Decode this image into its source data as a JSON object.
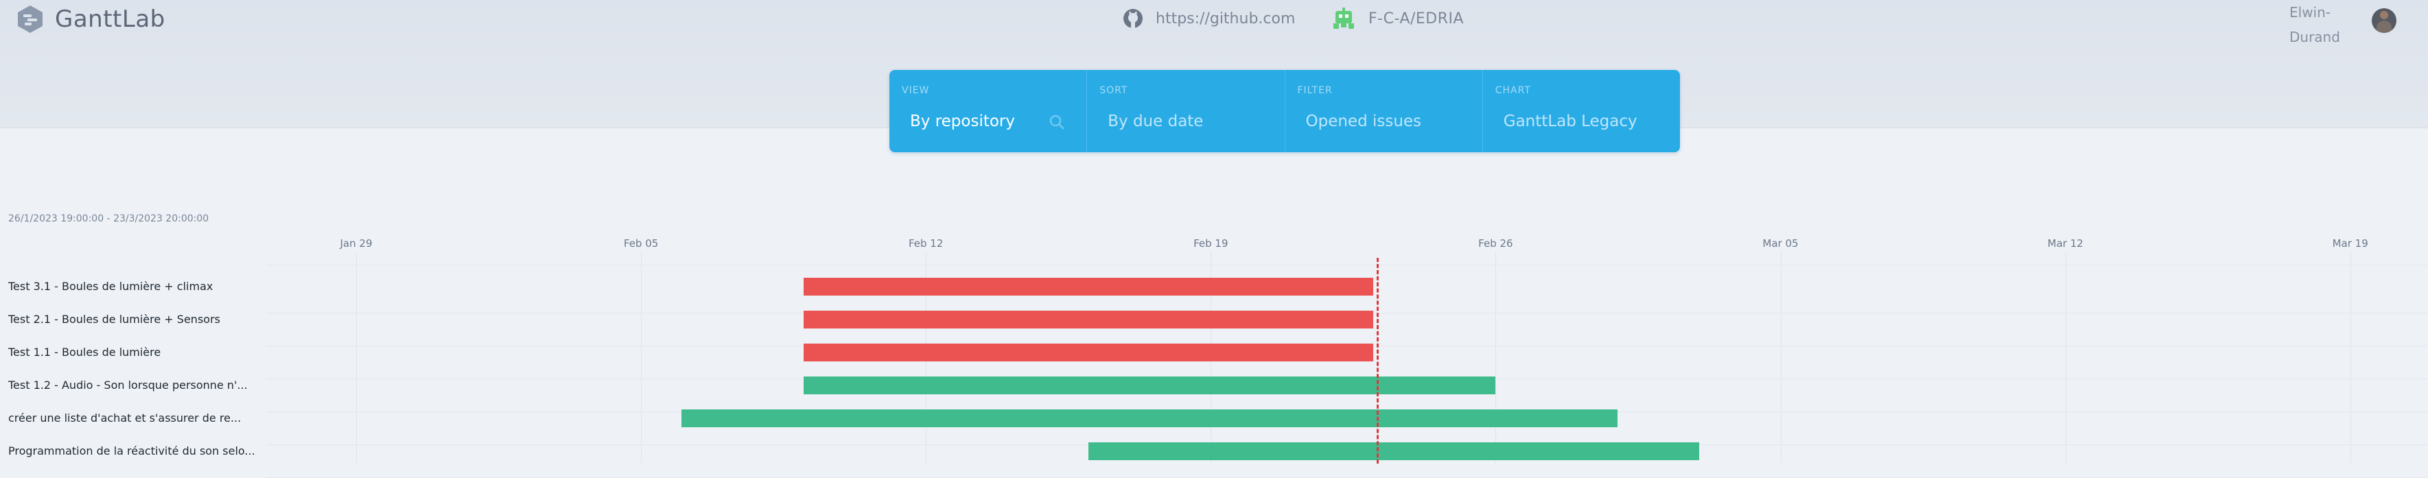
{
  "header": {
    "brand": "GanttLab",
    "source_url": "https://github.com",
    "repository": "F-C-A/EDRIA",
    "user_line1": "Elwin-",
    "user_line2": "Durand"
  },
  "toolbar": {
    "view": {
      "label": "VIEW",
      "value": "By repository"
    },
    "sort": {
      "label": "SORT",
      "value": "By due date"
    },
    "filter": {
      "label": "FILTER",
      "value": "Opened issues"
    },
    "chart": {
      "label": "CHART",
      "value": "GanttLab Legacy"
    }
  },
  "gantt": {
    "range": "26/1/2023 19:00:00 - 23/3/2023 20:00:00",
    "axis_ticks": [
      "Jan 29",
      "Feb 05",
      "Feb 12",
      "Feb 19",
      "Feb 26",
      "Mar 05",
      "Mar 12",
      "Mar 19"
    ],
    "rows": [
      {
        "label": "Test 3.1 - Boules de lumière + climax",
        "start": "2023-02-09",
        "end": "2023-02-23",
        "status": "overdue"
      },
      {
        "label": "Test 2.1 - Boules de lumière + Sensors",
        "start": "2023-02-09",
        "end": "2023-02-23",
        "status": "overdue"
      },
      {
        "label": "Test 1.1 - Boules de lumière",
        "start": "2023-02-09",
        "end": "2023-02-23",
        "status": "overdue"
      },
      {
        "label": "Test 1.2 - Audio - Son lorsque personne n'...",
        "start": "2023-02-09",
        "end": "2023-02-26",
        "status": "on-track"
      },
      {
        "label": "créer une liste d'achat et s'assurer de re...",
        "start": "2023-02-06",
        "end": "2023-03-01",
        "status": "on-track"
      },
      {
        "label": "Programmation de la réactivité du son selo...",
        "start": "2023-02-16",
        "end": "2023-03-03",
        "status": "on-track"
      }
    ]
  },
  "colors": {
    "overdue": "#eb5252",
    "on-track": "#40bb8e",
    "today-line": "#e0393b",
    "toolbar": "#29abe6"
  },
  "icons": {
    "logo": "ganttlab-logo-icon",
    "source": "github-icon",
    "repository": "gitlab-robot-icon",
    "view_search": "search-icon"
  }
}
